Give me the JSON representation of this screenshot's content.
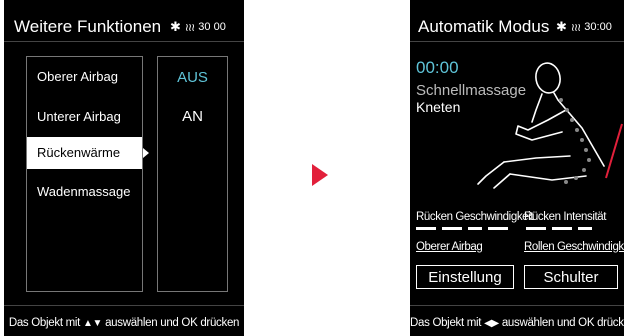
{
  "left_screen": {
    "title": "Weitere Funktionen",
    "status": "30 00",
    "menu_items": [
      "Oberer Airbag",
      "Unterer Airbag",
      "Rückenwärme",
      "Wadenmassage"
    ],
    "selected_index": 2,
    "values": [
      "AUS",
      "AN"
    ],
    "footer_pre": "Das Objekt mit",
    "footer_arrows": "▲▼",
    "footer_post": "auswählen und OK drücken"
  },
  "right_screen": {
    "title": "Automatik Modus",
    "status": "30:00",
    "timer": "00:00",
    "program": "Schnellmassage",
    "technique": "Kneten",
    "labels": {
      "back_speed": "Rücken Geschwindigkeit",
      "back_intensity": "Rücken Intensität",
      "upper_airbag": "Oberer Airbag",
      "roller_speed": "Rollen Geschwindigkeit"
    },
    "buttons": {
      "setting": "Einstellung",
      "shoulder": "Schulter"
    },
    "footer_pre": "Das Objekt mit",
    "footer_arrows": "◀▶",
    "footer_post": "auswählen und OK drücken"
  },
  "colors": {
    "accent": "#5fc4d8",
    "arrow": "#e2203b",
    "background": "#000000"
  },
  "icons": [
    "bluetooth-icon",
    "heat-icon",
    "massage-chair-figure-icon",
    "selection-arrow-icon"
  ]
}
